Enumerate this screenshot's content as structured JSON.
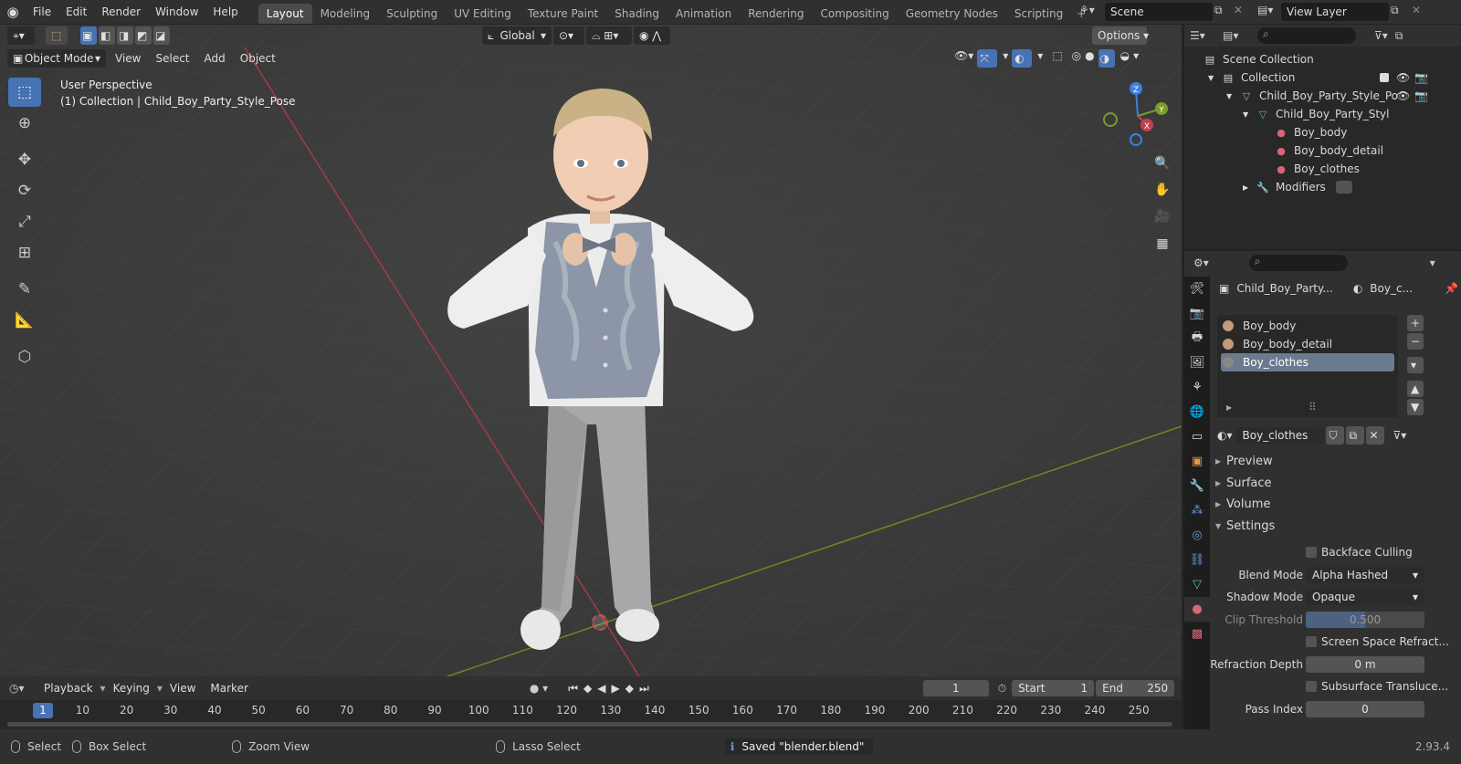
{
  "topbar": {
    "menus": [
      "File",
      "Edit",
      "Render",
      "Window",
      "Help"
    ],
    "workspaces": [
      "Layout",
      "Modeling",
      "Sculpting",
      "UV Editing",
      "Texture Paint",
      "Shading",
      "Animation",
      "Rendering",
      "Compositing",
      "Geometry Nodes",
      "Scripting"
    ],
    "active_workspace": "Layout",
    "scene": "Scene",
    "view_layer": "View Layer"
  },
  "viewport": {
    "transform_orientation": "Global",
    "options_label": "Options",
    "mode": "Object Mode",
    "menus": [
      "View",
      "Select",
      "Add",
      "Object"
    ],
    "perspective": "User Perspective",
    "context": "(1) Collection | Child_Boy_Party_Style_Pose",
    "gizmo": {
      "x": "X",
      "y": "Y",
      "z": "Z"
    }
  },
  "outliner": {
    "rows": [
      {
        "label": "Scene Collection"
      },
      {
        "label": "Collection"
      },
      {
        "label": "Child_Boy_Party_Style_Po"
      },
      {
        "label": "Child_Boy_Party_Styl"
      },
      {
        "label": "Boy_body"
      },
      {
        "label": "Boy_body_detail"
      },
      {
        "label": "Boy_clothes"
      },
      {
        "label": "Modifiers"
      }
    ]
  },
  "properties": {
    "object_name": "Child_Boy_Party...",
    "material_short": "Boy_c...",
    "slots": [
      "Boy_body",
      "Boy_body_detail",
      "Boy_clothes"
    ],
    "active_slot": "Boy_clothes",
    "material_name": "Boy_clothes",
    "sections": [
      "Preview",
      "Surface",
      "Volume",
      "Settings"
    ],
    "settings": {
      "backface_culling": "Backface Culling",
      "blend_mode_label": "Blend Mode",
      "blend_mode": "Alpha Hashed",
      "shadow_mode_label": "Shadow Mode",
      "shadow_mode": "Opaque",
      "clip_threshold_label": "Clip Threshold",
      "clip_threshold": "0.500",
      "screen_space_refraction": "Screen Space Refract...",
      "refraction_depth_label": "Refraction Depth",
      "refraction_depth": "0 m",
      "subsurface_translucency": "Subsurface Transluce...",
      "pass_index_label": "Pass Index",
      "pass_index": "0"
    }
  },
  "timeline": {
    "menus": [
      "Playback",
      "Keying",
      "View",
      "Marker"
    ],
    "current_frame": "1",
    "start_label": "Start",
    "start": "1",
    "end_label": "End",
    "end": "250",
    "ticks": [
      "10",
      "20",
      "30",
      "40",
      "50",
      "60",
      "70",
      "80",
      "90",
      "100",
      "110",
      "120",
      "130",
      "140",
      "150",
      "160",
      "170",
      "180",
      "190",
      "200",
      "210",
      "220",
      "230",
      "240",
      "250"
    ],
    "ruler_current": "1"
  },
  "statusbar": {
    "select": "Select",
    "box_select": "Box Select",
    "zoom_view": "Zoom View",
    "lasso_select": "Lasso Select",
    "message": "Saved \"blender.blend\"",
    "version": "2.93.4"
  },
  "colors": {
    "accent": "#4772b3",
    "x_axis": "#c3414b",
    "y_axis": "#7a9c2a",
    "z_axis": "#3d7fe0"
  }
}
